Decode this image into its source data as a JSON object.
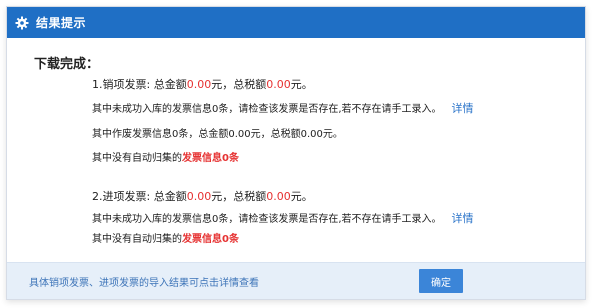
{
  "window": {
    "title": "结果提示",
    "icon": "gear-icon"
  },
  "heading": "下载完成：",
  "sales": {
    "label": "1.销项发票: 总金额",
    "amount": "0.00",
    "yuan1": "元，总税额",
    "tax": "0.00",
    "yuan2": "元。",
    "not_in_db": "其中未成功入库的发票信息0条，请检查该发票是否存在,若不存在请手工录入。",
    "detail_link": "详情",
    "voided": "其中作废发票信息0条，总金额0.00元，总税额0.00元。",
    "no_auto_prefix": "其中没有自动归集的",
    "no_auto_value": "发票信息0条"
  },
  "purchase": {
    "label": "2.进项发票: 总金额",
    "amount": "0.00",
    "yuan1": "元，总税额",
    "tax": "0.00",
    "yuan2": "元。",
    "not_in_db": "其中未成功入库的发票信息0条，请检查该发票是否存在,若不存在请手工录入。",
    "detail_link": "详情",
    "no_auto_prefix": "其中没有自动归集的",
    "no_auto_value": "发票信息0条"
  },
  "footer": {
    "note": "具体销项发票、进项发票的导入结果可点击详情查看",
    "confirm_label": "确定"
  },
  "colors": {
    "titlebar": "#1f6fc5",
    "highlight": "#e63232",
    "link": "#2b74c9",
    "footer_bg": "#e6eff9",
    "button": "#3b85d8"
  }
}
